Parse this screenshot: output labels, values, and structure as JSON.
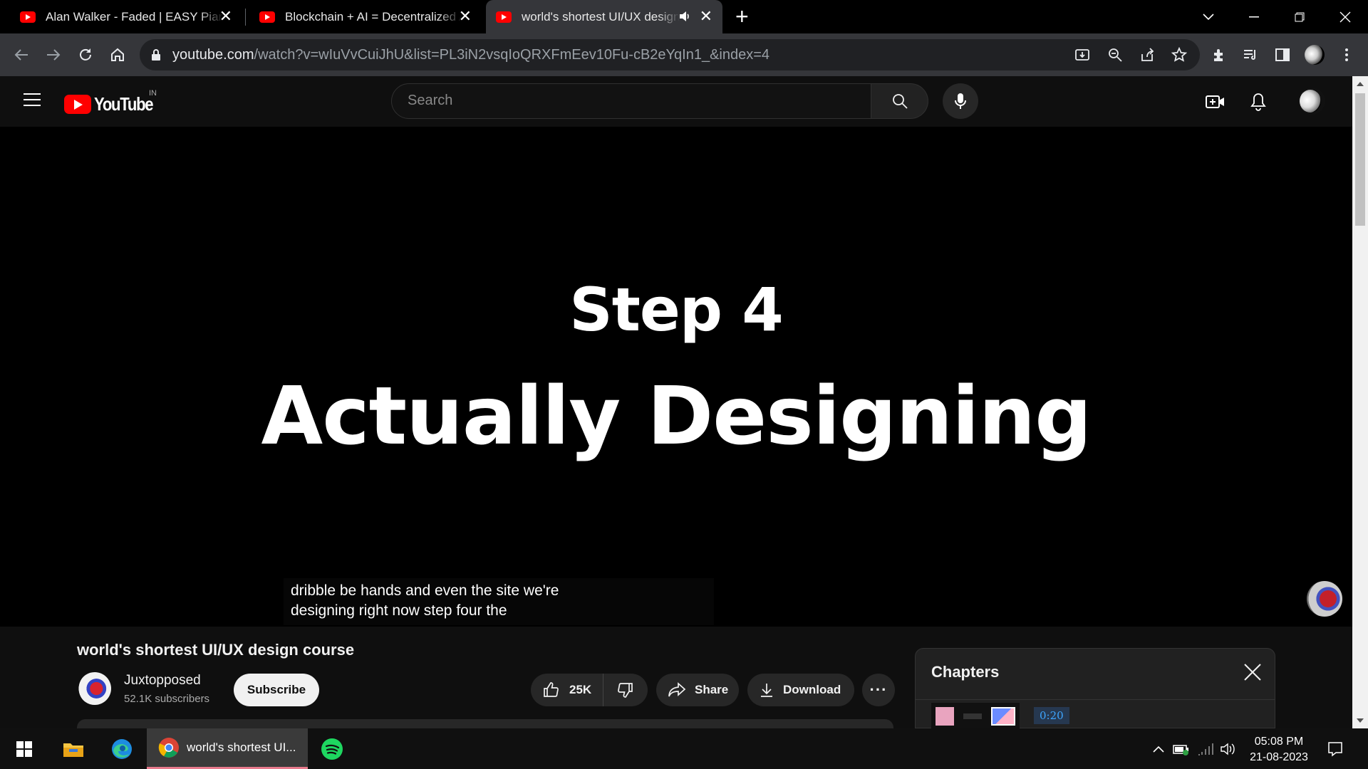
{
  "browser": {
    "tabs": [
      {
        "title": "Alan Walker - Faded | EASY Piano"
      },
      {
        "title": "Blockchain + AI = Decentralized AI"
      },
      {
        "title": "world's shortest UI/UX design course"
      }
    ],
    "url_host": "youtube.com",
    "url_path": "/watch?v=wIuVvCuiJhU&list=PL3iN2vsqIoQRXFmEev10Fu-cB2eYqIn1_&index=4"
  },
  "youtube": {
    "logo_text": "YouTube",
    "country_code": "IN",
    "search_placeholder": "Search"
  },
  "player": {
    "slide_title": "Step 4",
    "slide_subtitle": "Actually Designing",
    "caption_line1": "dribble be hands and even the site we're",
    "caption_line2": "designing right now step four the"
  },
  "video": {
    "title": "world's shortest UI/UX design course",
    "channel_name": "Juxtopposed",
    "subscribers": "52.1K subscribers",
    "subscribe_label": "Subscribe",
    "likes": "25K",
    "share_label": "Share",
    "download_label": "Download",
    "more_label": "···"
  },
  "chapters": {
    "title": "Chapters",
    "first_time": "0:20"
  },
  "taskbar": {
    "chrome_window_label": "world's shortest UI...",
    "time": "05:08 PM",
    "date": "21-08-2023"
  },
  "colors": {
    "youtube_red": "#ff0000",
    "chrome_toolbar": "#35363a",
    "yt_background": "#0f0f0f",
    "chapter_time_blue": "#3ea6ff"
  },
  "icons": [
    "youtube-favicon",
    "close-icon",
    "speaker-icon",
    "new-tab-icon",
    "back-icon",
    "forward-icon",
    "reload-icon",
    "home-icon",
    "lock-icon",
    "install-icon",
    "zoom-icon",
    "share-page-icon",
    "bookmark-star-icon",
    "extensions-icon",
    "media-control-icon",
    "side-panel-icon",
    "profile-icon",
    "menu-dots-icon",
    "hamburger-icon",
    "search-icon",
    "mic-icon",
    "create-icon",
    "bell-icon",
    "like-icon",
    "dislike-icon",
    "share-icon",
    "download-icon",
    "windows-start-icon",
    "file-explorer-icon",
    "edge-icon",
    "chrome-icon",
    "spotify-icon",
    "wifi-icon",
    "volume-icon",
    "battery-icon",
    "notification-icon"
  ]
}
